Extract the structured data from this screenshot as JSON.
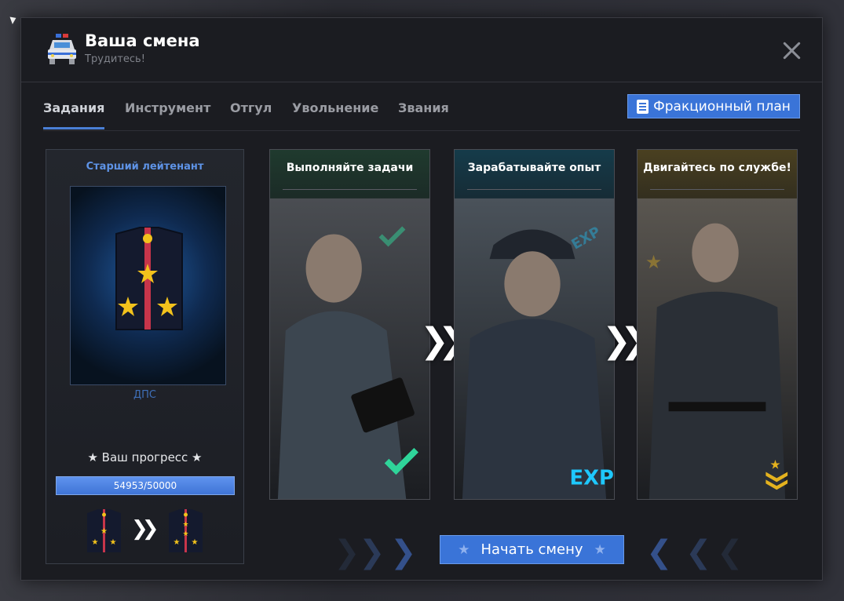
{
  "header": {
    "title": "Ваша смена",
    "subtitle": "Трудитесь!",
    "icon": "police-car-icon",
    "close_icon": "close-icon"
  },
  "tabs": [
    {
      "label": "Задания",
      "active": true
    },
    {
      "label": "Инструмент"
    },
    {
      "label": "Отгул"
    },
    {
      "label": "Увольнение"
    },
    {
      "label": "Звания"
    }
  ],
  "plan_button": {
    "label": "Фракционный план",
    "icon": "checklist-icon"
  },
  "rank": {
    "name": "Старший лейтенант",
    "department": "ДПС",
    "progress_label": "★ Ваш прогресс ★",
    "progress_text": "54953/50000",
    "progress_value": 54953,
    "progress_max": 50000,
    "current_insignia": "epaulette-3-stars-icon",
    "next_insignia": "epaulette-4-stars-icon"
  },
  "cards": [
    {
      "title": "Выполняйте задачи",
      "badge": "checkmark-icon",
      "accent": "#2fd59a"
    },
    {
      "title": "Зарабатывайте опыт",
      "badge": "EXP",
      "accent": "#1ec8ff"
    },
    {
      "title": "Двигайтесь по службе!",
      "badge": "rank-chevron-icon",
      "accent": "#e4b21e"
    }
  ],
  "start_button": {
    "label": "Начать смену"
  },
  "colors": {
    "accent": "#3a74d8",
    "panel": "#1b1c21"
  }
}
